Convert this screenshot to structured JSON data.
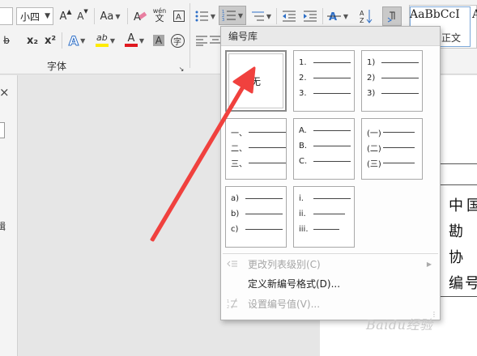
{
  "ribbon": {
    "font_size": "小四",
    "grow_font": "A",
    "shrink_font": "A",
    "change_case": "Aa",
    "phonetic_guide": "wén\n文",
    "subscript": "x₂",
    "superscript": "x²",
    "text_effect": "A",
    "highlight": "ab",
    "font_color": "A",
    "char_shading": "A",
    "enclose_char": "字",
    "font_group_label": "字体",
    "sort": "A↓",
    "style_sample_1": "AaBbCcI",
    "style_sample_2": "A",
    "style_name": "正文"
  },
  "dropdown": {
    "header": "编号库",
    "none_label": "无",
    "tiles": [
      {
        "labels": [
          "1.",
          "2.",
          "3."
        ]
      },
      {
        "labels": [
          "1)",
          "2)",
          "3)"
        ]
      },
      {
        "labels": [
          "一、",
          "二、",
          "三、"
        ]
      },
      {
        "labels": [
          "A.",
          "B.",
          "C."
        ]
      },
      {
        "labels": [
          "(一)",
          "(二)",
          "(三)"
        ]
      },
      {
        "labels": [
          "a)",
          "b)",
          "c)"
        ]
      },
      {
        "labels": [
          "i.",
          "ii.",
          "iii."
        ]
      }
    ],
    "menu_items": [
      {
        "label": "更改列表级别(C)",
        "enabled": false,
        "icon": "indent-icon",
        "submenu": true
      },
      {
        "label": "定义新编号格式(D)...",
        "enabled": true,
        "icon": "",
        "submenu": false
      },
      {
        "label": "设置编号值(V)...",
        "enabled": false,
        "icon": "number-value-icon",
        "submenu": false
      }
    ]
  },
  "document": {
    "chars": [
      "中",
      "国",
      "勘",
      "协",
      "编",
      "号"
    ]
  },
  "left_pane": {
    "close": "×",
    "partial_char": "辑"
  },
  "watermark": "Baidu经验",
  "colors": {
    "arrow": "#f0413e",
    "highlight_yellow": "#ffeb00",
    "font_red": "#e0191f"
  }
}
